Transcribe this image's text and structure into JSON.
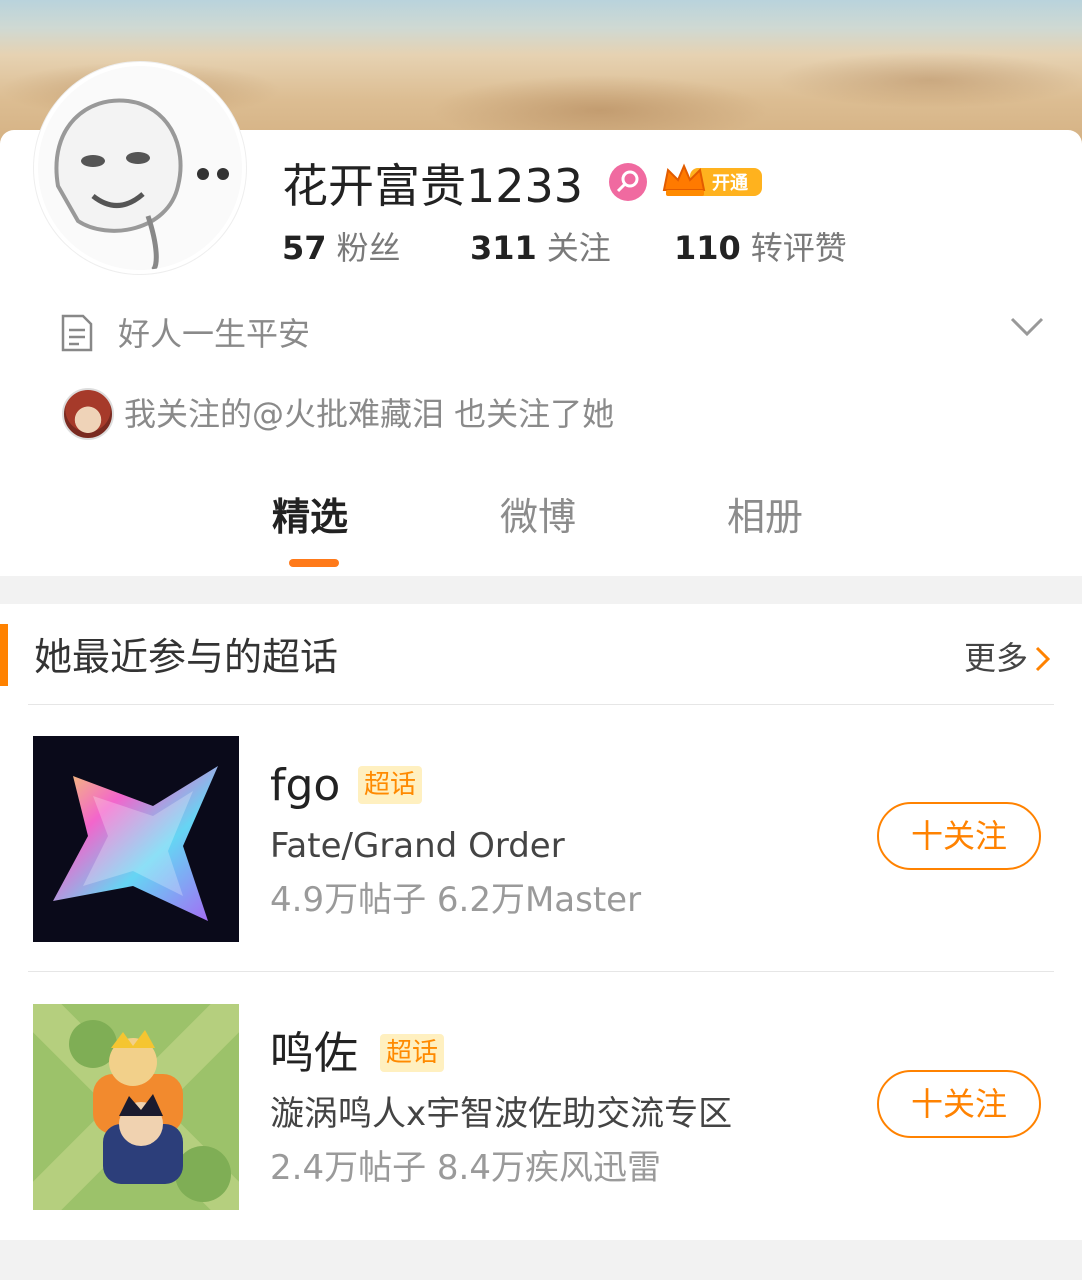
{
  "profile": {
    "username": "花开富贵1233",
    "vip_badge_label": "开通",
    "stats": [
      {
        "value": "57",
        "label": "粉丝"
      },
      {
        "value": "311",
        "label": "关注"
      },
      {
        "value": "110",
        "label": "转评赞"
      }
    ],
    "bio": "好人一生平安",
    "mutual_follow_text": "我关注的@火批难藏泪 也关注了她"
  },
  "tabs": [
    {
      "label": "精选",
      "active": true
    },
    {
      "label": "微博",
      "active": false
    },
    {
      "label": "相册",
      "active": false
    }
  ],
  "super_topics": {
    "title": "她最近参与的超话",
    "more_label": "更多",
    "items": [
      {
        "name": "fgo",
        "badge": "超话",
        "subtitle": "Fate/Grand Order",
        "stats": "4.9万帖子 6.2万Master",
        "follow_label": "十关注"
      },
      {
        "name": "鸣佐",
        "badge": "超话",
        "subtitle": "漩涡鸣人x宇智波佐助交流专区",
        "stats": "2.4万帖子 8.4万疾风迅雷",
        "follow_label": "十关注"
      }
    ]
  },
  "colors": {
    "accent": "#ff8200",
    "badge_bg": "#fff0c0",
    "gender_pink": "#f06aa0"
  },
  "icons": {
    "gender": "female-symbol-icon",
    "vip": "crown-icon",
    "bio": "document-icon",
    "expand": "chevron-down-icon",
    "more": "chevron-right-icon"
  }
}
